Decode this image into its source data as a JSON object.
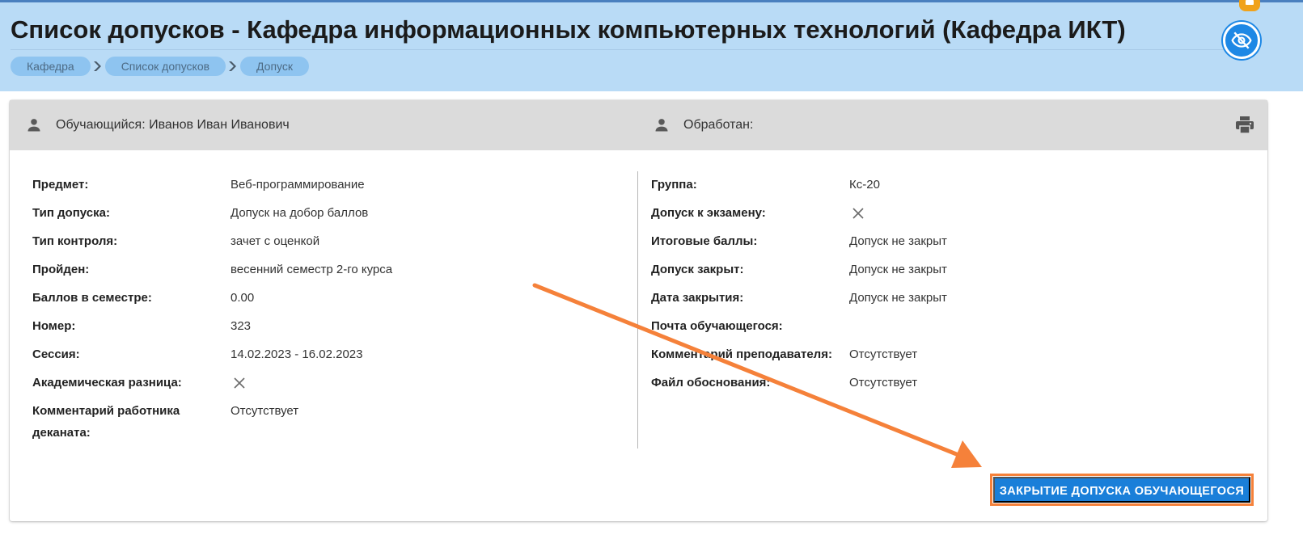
{
  "header": {
    "title": "Список допусков - Кафедра информационных компьютерных технологий (Кафедра ИКТ)",
    "breadcrumbs": [
      "Кафедра",
      "Список допусков",
      "Допуск"
    ]
  },
  "card_header": {
    "student_label": "Обучающийся: Иванов Иван Иванович",
    "processed_label": "Обработан:"
  },
  "left_fields": [
    {
      "label": "Предмет:",
      "value": "Веб-программирование"
    },
    {
      "label": "Тип допуска:",
      "value": "Допуск на добор баллов"
    },
    {
      "label": "Тип контроля:",
      "value": "зачет с оценкой"
    },
    {
      "label": "Пройден:",
      "value": "весенний семестр 2-го курса"
    },
    {
      "label": "Баллов в семестре:",
      "value": "0.00"
    },
    {
      "label": "Номер:",
      "value": "323"
    },
    {
      "label": "Сессия:",
      "value": "14.02.2023 - 16.02.2023"
    },
    {
      "label": "Академическая разница:",
      "value": ""
    },
    {
      "label": "Комментарий работника деканата:",
      "value": "Отсутствует"
    }
  ],
  "right_fields": [
    {
      "label": "Группа:",
      "value": "Кс-20"
    },
    {
      "label": "Допуск к экзамену:",
      "value": ""
    },
    {
      "label": "Итоговые баллы:",
      "value": "Допуск не закрыт"
    },
    {
      "label": "Допуск закрыт:",
      "value": "Допуск не закрыт"
    },
    {
      "label": "Дата закрытия:",
      "value": "Допуск не закрыт"
    },
    {
      "label": "Почта обучающегося:",
      "value": ""
    },
    {
      "label": "Комментарий преподавателя:",
      "value": "Отсутствует"
    },
    {
      "label": "Файл обоснования:",
      "value": "Отсутствует"
    }
  ],
  "action": {
    "close_button": "ЗАКРЫТИЕ ДОПУСКА ОБУЧАЮЩЕГОСЯ"
  },
  "icons": {
    "eye": "eye-off-icon",
    "person": "person-icon",
    "print": "print-icon",
    "false_value": "close-x-icon",
    "notification": "notification-badge-icon"
  },
  "colors": {
    "header_bg": "#b9dbf6",
    "breadcrumb_bg": "#8ec4f0",
    "primary": "#1a7fd9",
    "annotation": "#f5813a"
  }
}
